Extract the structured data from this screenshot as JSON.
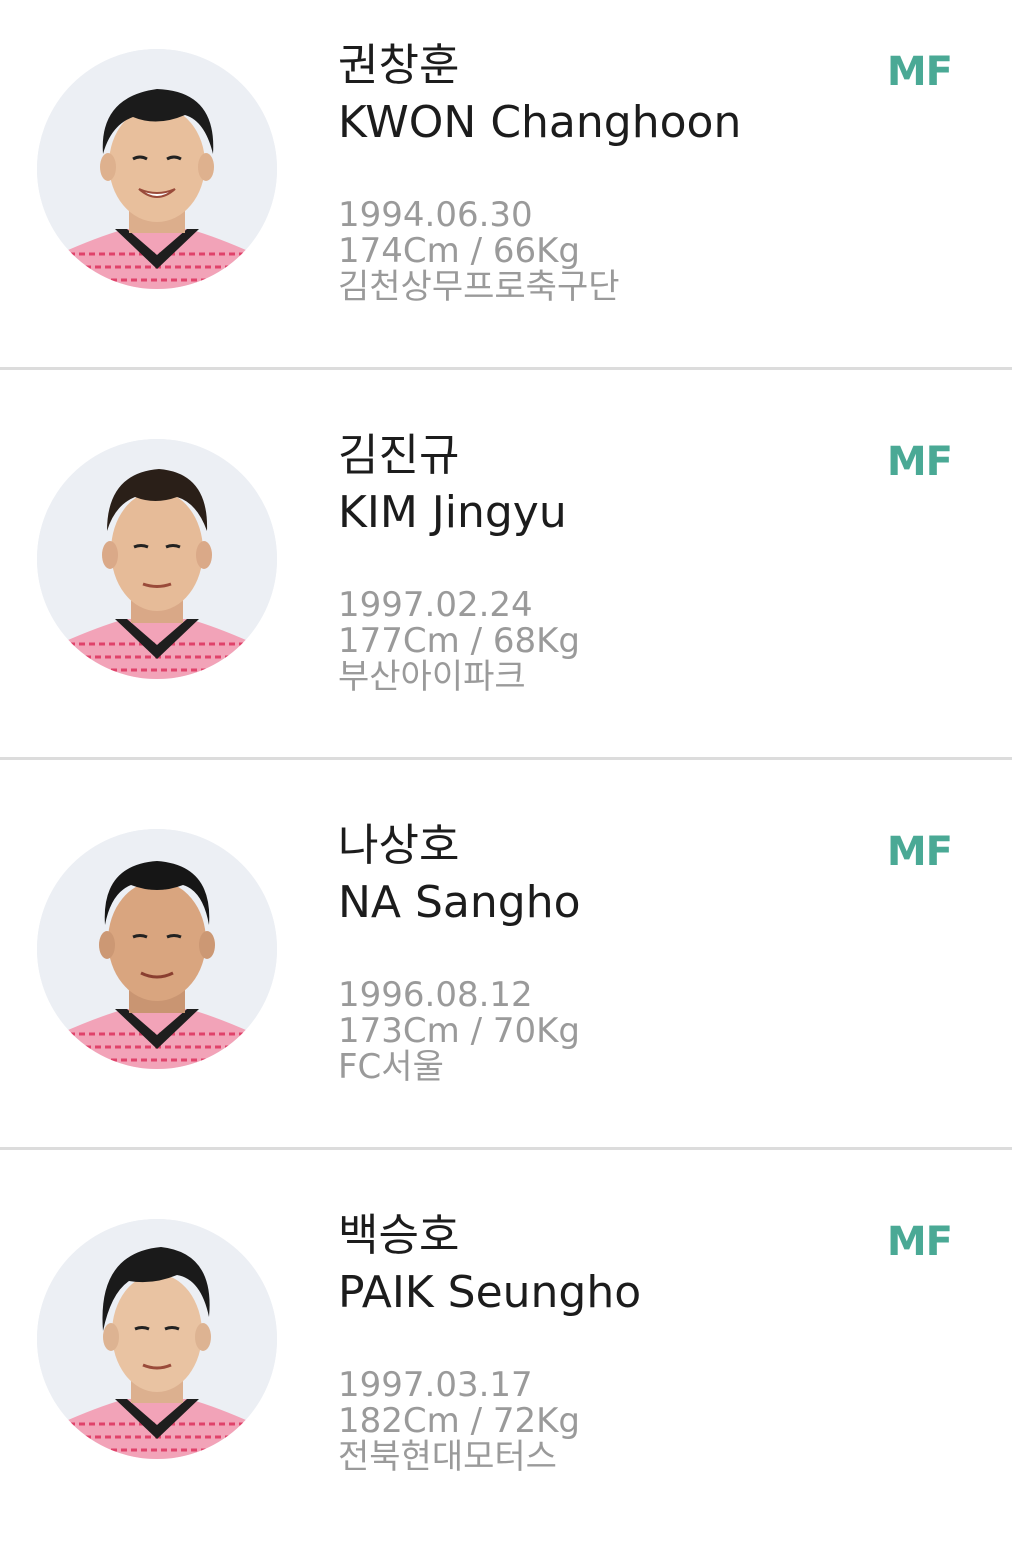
{
  "players": [
    {
      "name_ko": "권창훈",
      "name_en": "KWON Changhoon",
      "birth": "1994.06.30",
      "body": "174Cm / 66Kg",
      "club": "김천상무프로축구단",
      "position": "MF"
    },
    {
      "name_ko": "김진규",
      "name_en": "KIM Jingyu",
      "birth": "1997.02.24",
      "body": "177Cm / 68Kg",
      "club": "부산아이파크",
      "position": "MF"
    },
    {
      "name_ko": "나상호",
      "name_en": "NA Sangho",
      "birth": "1996.08.12",
      "body": "173Cm / 70Kg",
      "club": "FC서울",
      "position": "MF"
    },
    {
      "name_ko": "백승호",
      "name_en": "PAIK Seungho",
      "birth": "1997.03.17",
      "body": "182Cm / 72Kg",
      "club": "전북현대모터스",
      "position": "MF"
    }
  ],
  "colors": {
    "position_accent": "#4aa995",
    "name_text": "#1c1c1c",
    "info_text": "#9a9a9a",
    "divider": "#dcdcdc",
    "jersey": "#f2a3b8",
    "jersey_pattern": "#e0426a",
    "avatar_bg": "#eceff4"
  }
}
